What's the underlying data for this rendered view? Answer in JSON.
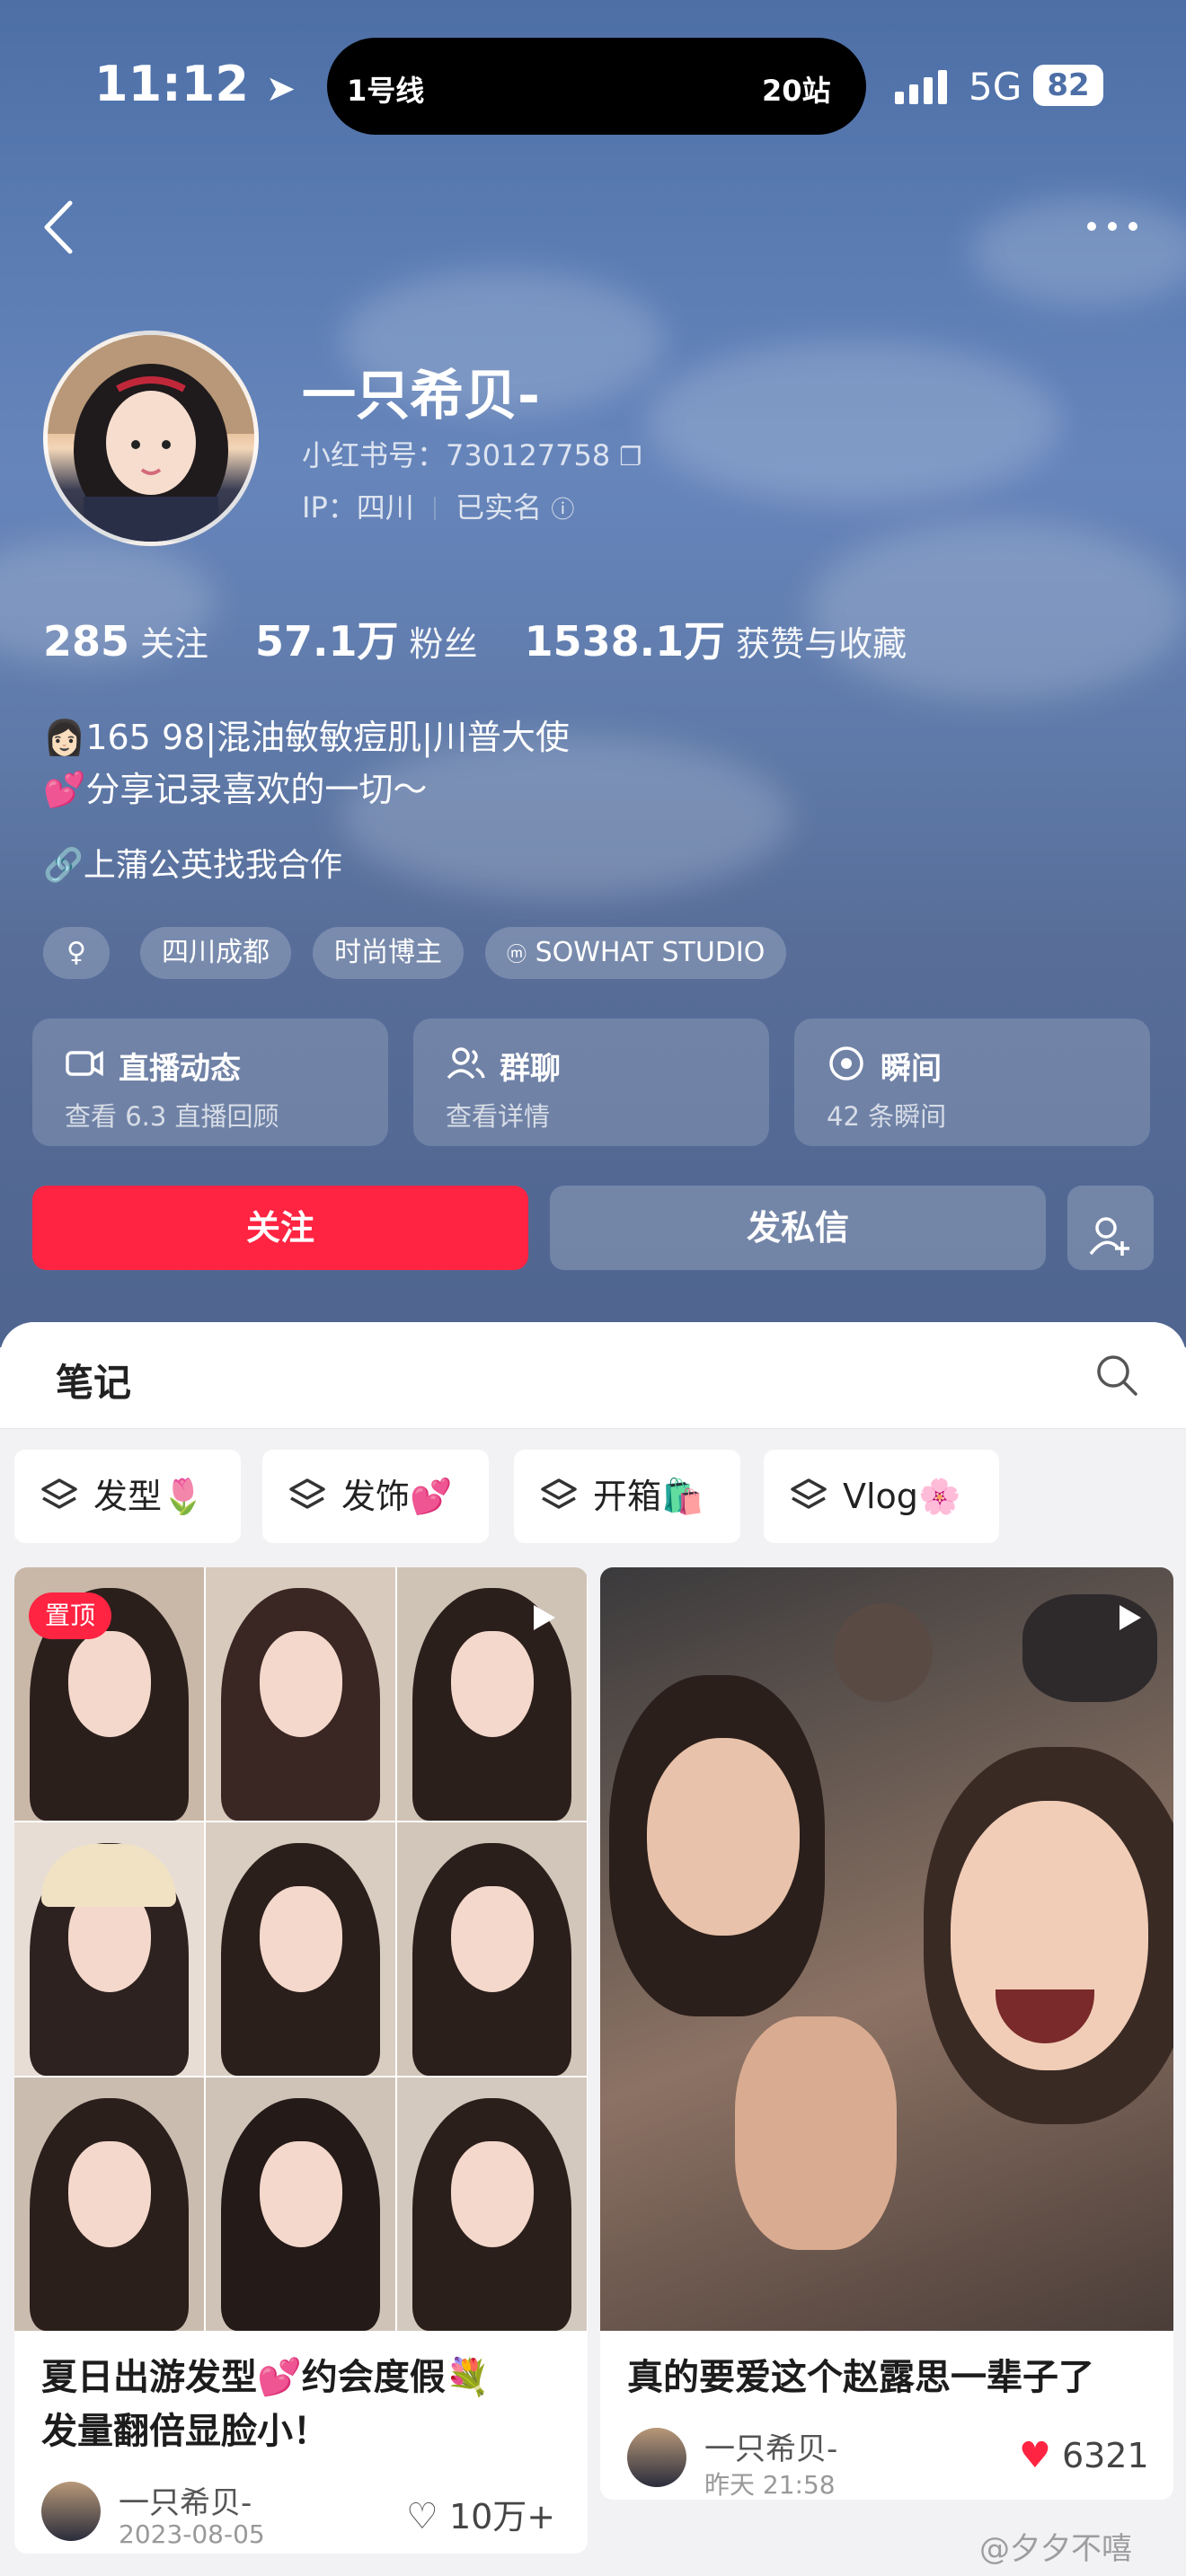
{
  "status_bar": {
    "time": "11:12",
    "island_left": "1号线",
    "island_right": "20站",
    "network": "5G",
    "battery": "82"
  },
  "profile": {
    "name": "一只希贝-",
    "red_id": "小红书号：730127758",
    "ip_label": "IP：",
    "ip_location": "四川",
    "verified": "已实名",
    "stats": {
      "following_count": "285",
      "following_label": "关注",
      "followers_count": "57.1万",
      "followers_label": "粉丝",
      "likes_count": "1538.1万",
      "likes_label": "获赞与收藏"
    },
    "bio": [
      "165 98|混油敏敏痘肌|川普大使",
      "分享记录喜欢的一切～"
    ],
    "link": "上蒲公英找我合作",
    "tags": [
      "♀",
      "四川成都",
      "时尚博主",
      "SOWHAT STUDIO"
    ]
  },
  "cards": [
    {
      "title": "直播动态",
      "subtitle": "查看 6.3 直播回顾",
      "icon": "live-camera-icon"
    },
    {
      "title": "群聊",
      "subtitle": "查看详情",
      "icon": "group-chat-icon"
    },
    {
      "title": "瞬间",
      "subtitle": "42 条瞬间",
      "icon": "moment-icon"
    }
  ],
  "actions": {
    "follow": "关注",
    "message": "发私信"
  },
  "notes_tab": {
    "label": "笔记"
  },
  "collections": [
    {
      "label": "发型",
      "emoji": "🌷"
    },
    {
      "label": "发饰",
      "emoji": "💕"
    },
    {
      "label": "开箱",
      "emoji": "🛍️"
    },
    {
      "label": "Vlog",
      "emoji": "🌸"
    }
  ],
  "notes": [
    {
      "pinned": "置顶",
      "title_line1": "夏日出游发型💕约会度假💐",
      "title_line2": "发量翻倍显脸小！",
      "author": "一只希贝-",
      "date": "2023-08-05",
      "likes": "10万+"
    },
    {
      "title_line1": "真的要爱这个赵露思一辈子了",
      "author": "一只希贝-",
      "date": "昨天 21:58",
      "likes": "6321"
    }
  ],
  "watermark": "@夕夕不嘻",
  "colors": {
    "accent": "#ff2442",
    "header_bg": "#5a7cb3"
  }
}
